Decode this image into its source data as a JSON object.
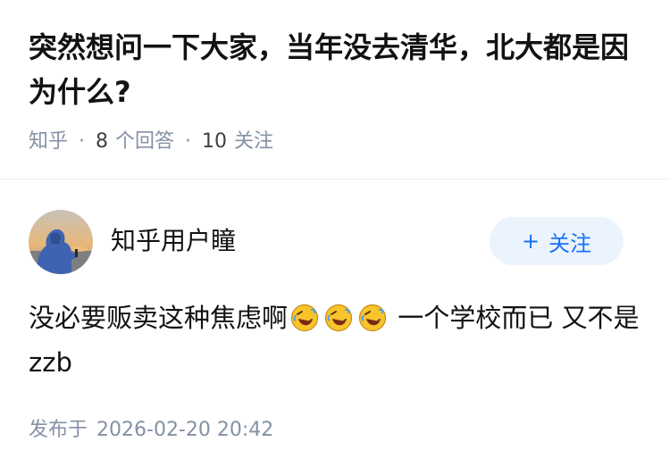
{
  "question": {
    "title": "突然想问一下大家，当年没去清华，北大都是因为什么?",
    "source": "知乎",
    "separator": "·",
    "answer_count": "8",
    "answer_label": "个回答",
    "follower_count": "10",
    "follower_label": "关注"
  },
  "answer": {
    "author_name": "知乎用户瞳",
    "follow_button": {
      "icon": "+",
      "label": "关注"
    },
    "content_before": "没必要贩卖这种焦虑啊",
    "emojis": [
      "rofl-emoji",
      "rofl-emoji",
      "rofl-emoji"
    ],
    "content_after": " 一个学校而已 又不是zzb",
    "publish_label": "发布于",
    "publish_time": "2026-02-20 20:42"
  },
  "colors": {
    "accent": "#1772f6",
    "follow_bg": "#ebf3fd",
    "meta": "#8590a6",
    "text": "#121212"
  }
}
